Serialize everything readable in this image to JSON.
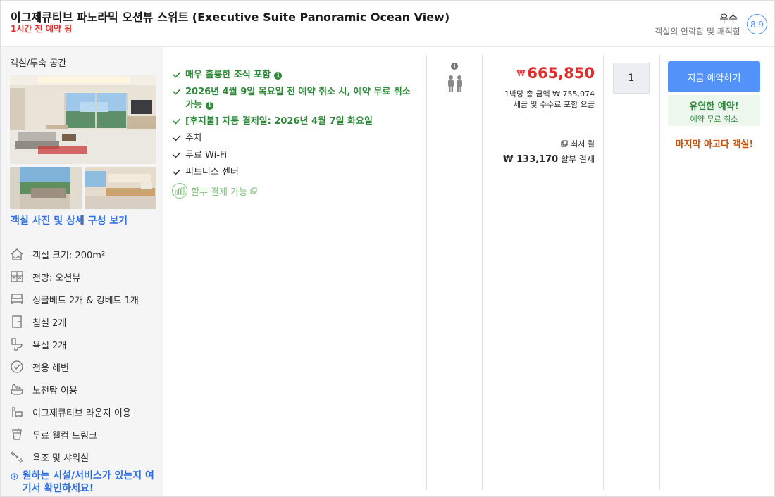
{
  "header": {
    "room_title": "이그제큐티브 파노라믹 오션뷰 스위트 (Executive Suite Panoramic Ocean View)",
    "booked_note": "1시간 전 예약 됨",
    "rating_word": "우수",
    "rating_sub": "객실의 안락함 및 쾌적함",
    "rating_score": "8.9"
  },
  "left": {
    "section_title": "객실/투숙 공간",
    "photo_link": "객실 사진 및 상세 구성 보기",
    "features": [
      {
        "icon": "house-icon",
        "label": "객실 크기: 200m²"
      },
      {
        "icon": "window-icon",
        "label": "전망: 오션뷰"
      },
      {
        "icon": "bed-icon",
        "label": "싱글베드 2개 & 킹베드 1개"
      },
      {
        "icon": "door-icon",
        "label": "침실 2개"
      },
      {
        "icon": "toilet-icon",
        "label": "욕실 2개"
      },
      {
        "icon": "check-circle-icon",
        "label": "전용 해변"
      },
      {
        "icon": "bathtub-icon",
        "label": "노천탕 이용"
      },
      {
        "icon": "lounge-icon",
        "label": "이그제큐티브 라운지 이용"
      },
      {
        "icon": "cup-icon",
        "label": "무료 웰컴 드링크"
      },
      {
        "icon": "shower-icon",
        "label": "욕조 및 샤워실"
      }
    ],
    "more_link": "원하는 시설/서비스가 있는지 여기서 확인하세요!"
  },
  "benefits": {
    "items": [
      {
        "text": "매우 훌륭한 조식 포함",
        "style": "green",
        "info": true
      },
      {
        "text": "2026년 4월 9일 목요일 전 예약 취소 시, 예약 무료 취소 가능",
        "style": "green",
        "info": true
      },
      {
        "text": "[후지불] 자동 결제일: 2026년 4월 7일 화요일",
        "style": "green",
        "info": false
      },
      {
        "text": "주차",
        "style": "plain",
        "info": false
      },
      {
        "text": "무료 Wi-Fi",
        "style": "plain",
        "info": false
      },
      {
        "text": "피트니스 센터",
        "style": "plain",
        "info": false
      }
    ],
    "installment": "할부 결제 가능"
  },
  "price": {
    "currency": "₩",
    "amount": "665,850",
    "total_line": "1박당 총 금액 ₩ 755,074",
    "tax_line": "세금 및 수수료 포함 요금",
    "min_monthly_label": "최저 월",
    "monthly_amount": "₩ 133,170",
    "monthly_suffix": "할부 결제"
  },
  "quantity": {
    "value": "1"
  },
  "booking": {
    "button_label": "지금 예약하기",
    "flex_title": "유연한 예약!",
    "flex_sub": "예약 무료 취소",
    "last_room": "마지막 아고다 객실!"
  },
  "colors": {
    "accent_blue": "#5392f9",
    "price_red": "#e12d2d",
    "benefit_green": "#2e8a3a",
    "urgency_orange": "#c9510c"
  }
}
